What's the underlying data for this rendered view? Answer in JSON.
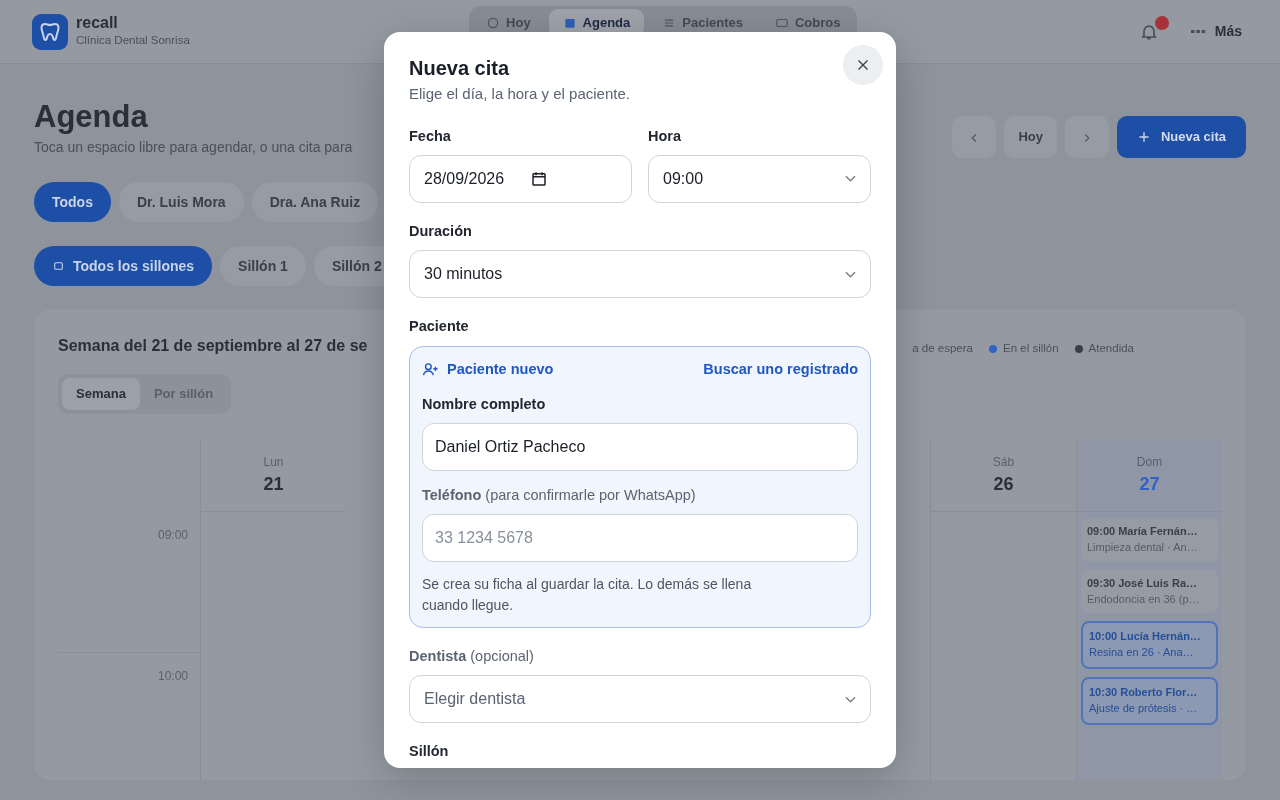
{
  "app": {
    "name": "recall",
    "subtitle": "Clínica Dental Sonrisa"
  },
  "nav": [
    {
      "label": "Hoy",
      "selected": false,
      "kind": "home"
    },
    {
      "label": "Agenda",
      "selected": true,
      "kind": "calendar"
    },
    {
      "label": "Pacientes",
      "selected": false,
      "kind": "list"
    },
    {
      "label": "Cobros",
      "selected": false,
      "kind": "card"
    }
  ],
  "more": {
    "label": "Más"
  },
  "page": {
    "title": "Agenda",
    "subtitle": "Toca un espacio libre para agendar, o una cita para"
  },
  "toolbar": {
    "today": "Hoy",
    "new_button": "Nueva cita"
  },
  "dentist_filters": [
    {
      "label": "Todos",
      "selected": true
    },
    {
      "label": "Dr. Luis Mora",
      "selected": false
    },
    {
      "label": "Dra. Ana Ruiz",
      "selected": false
    }
  ],
  "chair_filters": [
    {
      "label": "Todos los sillones",
      "selected": true
    },
    {
      "label": "Sillón 1",
      "selected": false
    },
    {
      "label": "Sillón 2",
      "selected": false
    }
  ],
  "calendar": {
    "title": "Semana del 21 de septiembre al 27 de se",
    "views": [
      {
        "label": "Semana",
        "selected": true
      },
      {
        "label": "Por sillón",
        "selected": false
      }
    ],
    "legend": [
      {
        "label": "a de espera"
      },
      {
        "label": "En el sillón",
        "color": "#2f62c4"
      },
      {
        "label": "Atendida",
        "color": "#3a3e46"
      }
    ],
    "times": [
      "09:00",
      "10:00"
    ],
    "days": [
      {
        "weekday": "Lun",
        "day": "21",
        "today": false
      },
      {
        "weekday": "Sáb",
        "day": "26",
        "today": false
      },
      {
        "weekday": "Dom",
        "day": "27",
        "today": true,
        "events": [
          {
            "title": "09:00 María Fernán…",
            "detail": "Limpieza dental · An…",
            "kind": "scheduled"
          },
          {
            "title": "09:30 José Luis Ra…",
            "detail": "Endodoncia en 36 (p…",
            "kind": "scheduled"
          },
          {
            "title": "10:00 Lucía Hernán…",
            "detail": "Resina en 26 · Ana…",
            "kind": "in_chair"
          },
          {
            "title": "10:30 Roberto Flor…",
            "detail": "Ajuste de prótesis · …",
            "kind": "in_chair"
          }
        ]
      }
    ]
  },
  "modal": {
    "title": "Nueva cita",
    "subtitle": "Elige el día, la hora y el paciente.",
    "date": {
      "label": "Fecha",
      "value": "28/09/2026"
    },
    "time": {
      "label": "Hora",
      "value": "09:00"
    },
    "duration": {
      "label": "Duración",
      "value": "30 minutos"
    },
    "patient": {
      "label": "Paciente",
      "mode": "Paciente nuevo",
      "switch_link": "Buscar uno registrado",
      "name_label": "Nombre completo",
      "name_value": "Daniel Ortiz Pacheco",
      "phone_label": "**Teléfono** (para confirmarle por WhatsApp)",
      "phone_placeholder": "33 1234 5678",
      "note": "Se crea su ficha al guardar la cita. Lo demás se llena cuando llegue."
    },
    "dentist": {
      "label": "**Dentista** (opcional)",
      "placeholder": "Elegir dentista"
    },
    "chair": {
      "label": "Sillón"
    }
  }
}
